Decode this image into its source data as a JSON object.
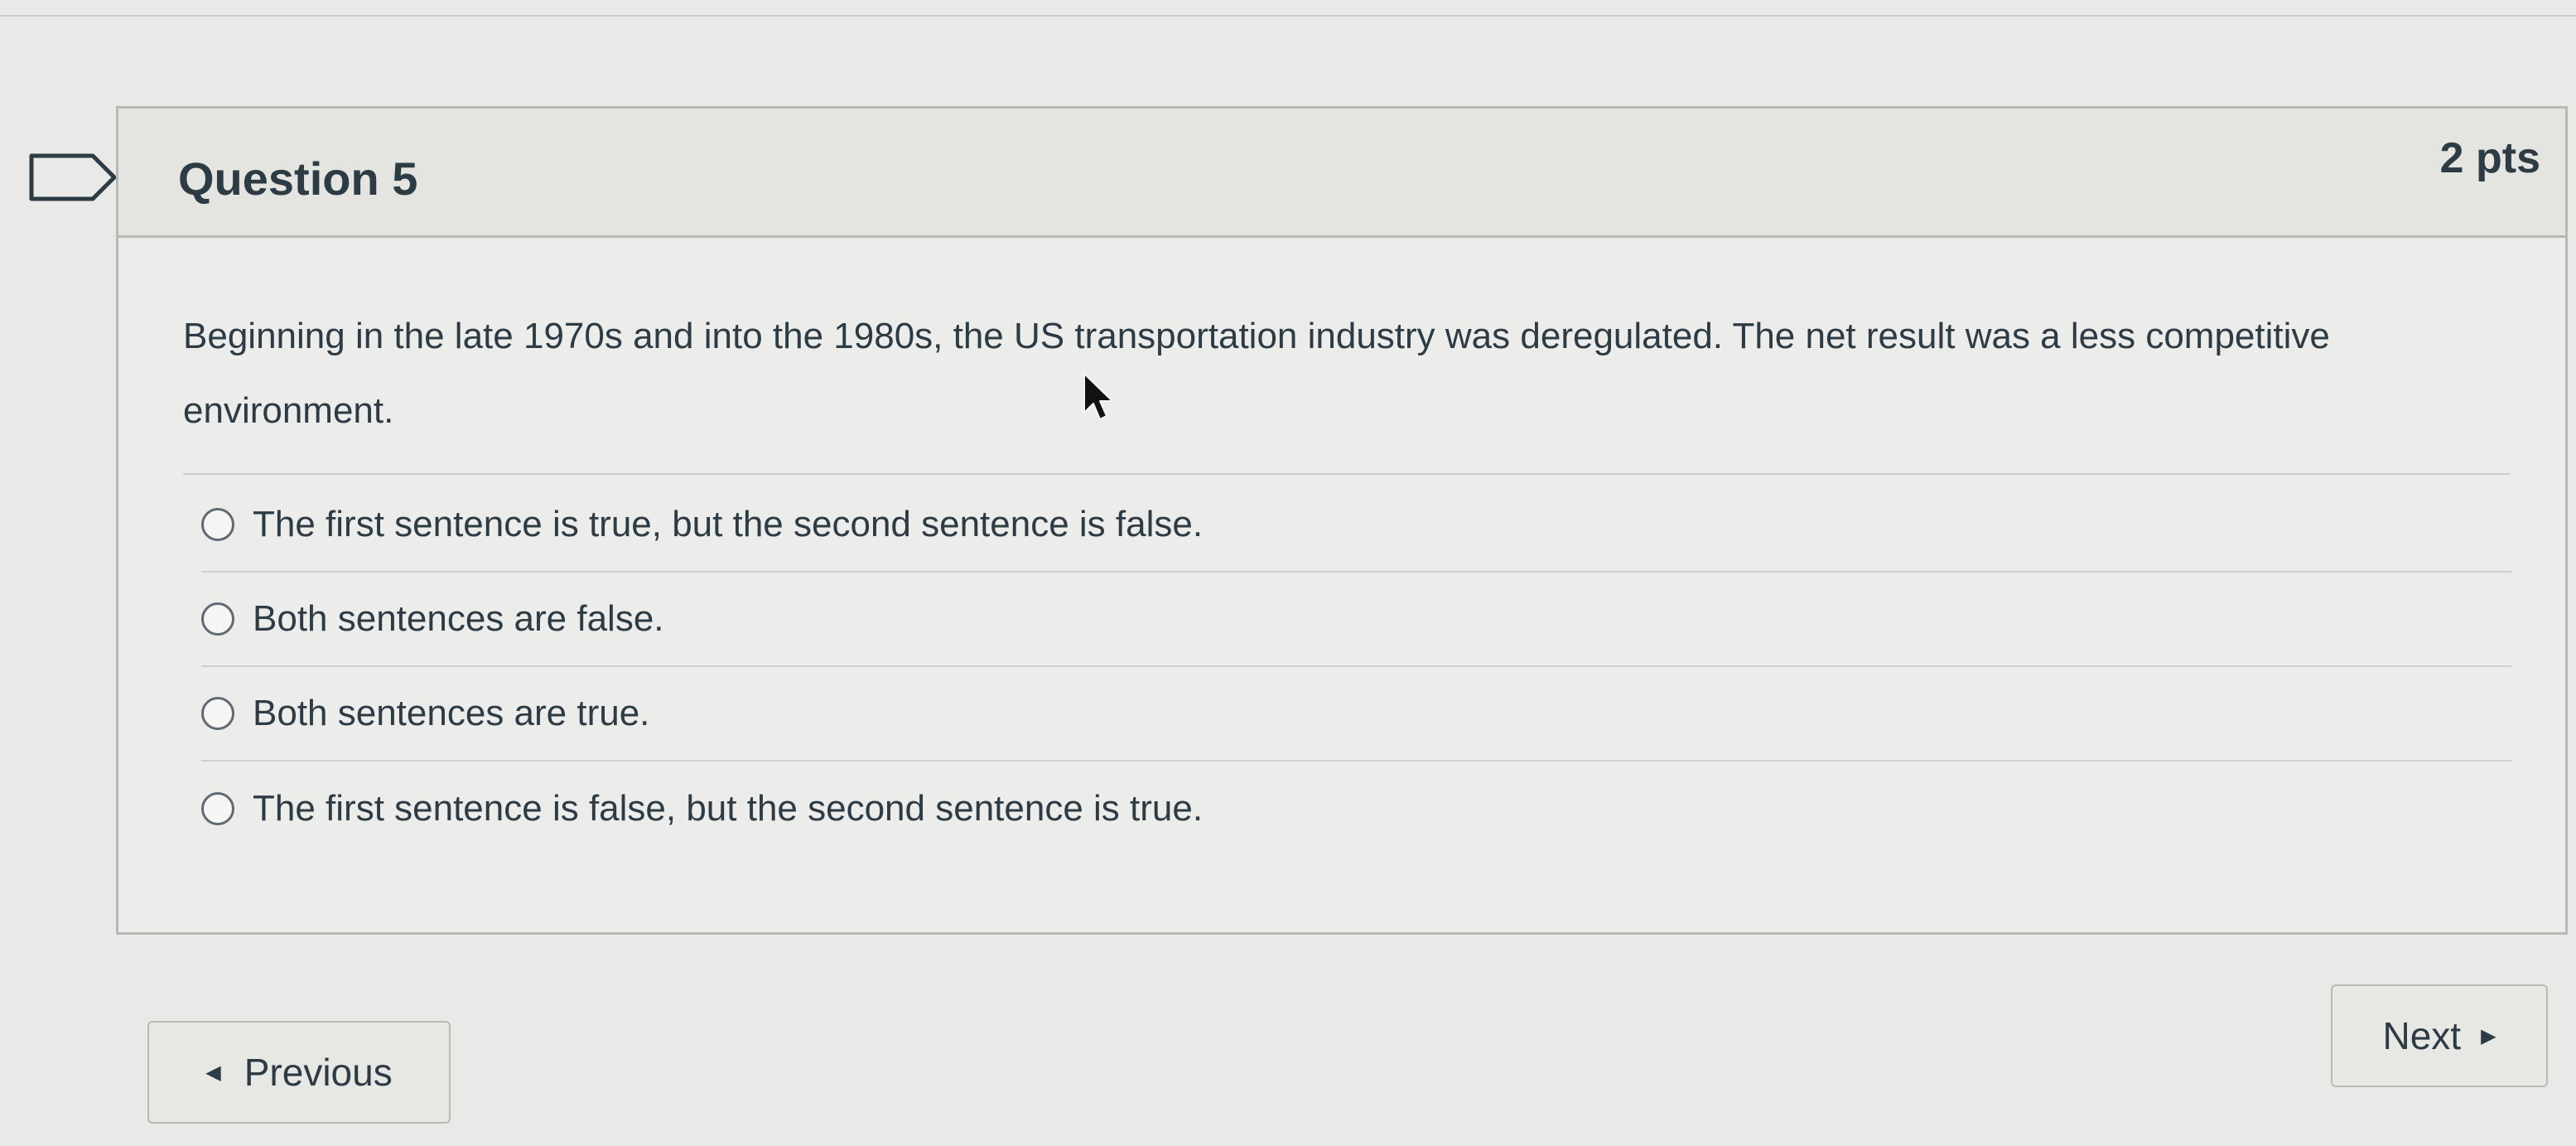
{
  "question": {
    "title": "Question 5",
    "points": "2 pts",
    "text": "Beginning in the late 1970s and into the 1980s, the US transportation industry was deregulated. The net result was a less competitive environment.",
    "answers": [
      {
        "label": "The first sentence is true, but the second sentence is false."
      },
      {
        "label": "Both sentences are false."
      },
      {
        "label": "Both sentences are true."
      },
      {
        "label": "The first sentence is false, but the second sentence is true."
      }
    ]
  },
  "navigation": {
    "previous_label": "Previous",
    "next_label": "Next"
  },
  "icons": {
    "bookmark": "bookmark-icon",
    "previous": "triangle-left-icon",
    "next": "triangle-right-icon",
    "cursor": "mouse-pointer-icon"
  }
}
